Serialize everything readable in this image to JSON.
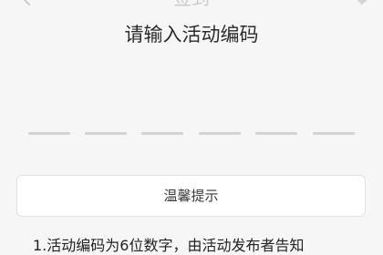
{
  "nav": {
    "title": "签到",
    "back_icon": "chevron-left-icon",
    "favorite_icon": "heart-icon"
  },
  "prompt": {
    "heading": "请输入活动编码"
  },
  "code_input": {
    "length": 6,
    "slots": [
      "",
      "",
      "",
      "",
      "",
      ""
    ]
  },
  "tips": {
    "button_label": "温馨提示",
    "lines": [
      "1.活动编码为6位数字，由活动发布者告知"
    ]
  },
  "colors": {
    "background": "#f6f6f6",
    "slot_line": "#d3d3d3",
    "heading_text": "#2b2b2b",
    "button_bg": "#ffffff"
  }
}
